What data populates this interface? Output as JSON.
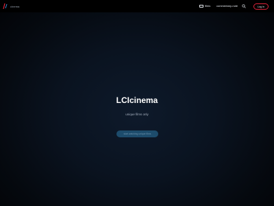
{
  "navbar": {
    "logo_text": "cinema",
    "films_label": "films",
    "commentary_label": "commentary-note",
    "login_label": "Log in"
  },
  "icons": {
    "logo": "lci-logo-mark",
    "films": "film-icon",
    "search": "search-icon"
  },
  "hero": {
    "title": "LCIcinema",
    "subtitle": "unique films only",
    "cta_label": "start watching unique films"
  },
  "colors": {
    "accent": "#e0243a",
    "cta_background": "#1d4c6c",
    "background": "#0a1320"
  }
}
